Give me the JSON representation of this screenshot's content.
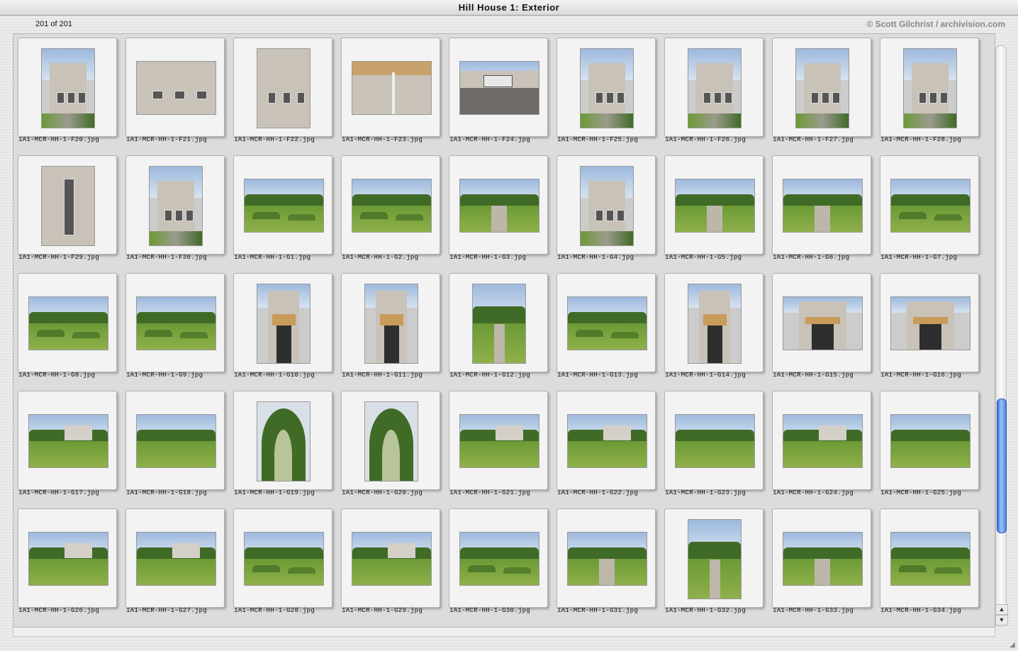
{
  "window": {
    "title": "Hill House 1: Exterior",
    "count_text": "201 of 201",
    "copyright": "© Scott Gilchrist / archivision.com"
  },
  "scroll": {
    "position": 0.72
  },
  "thumbnails": [
    {
      "label": "1A1-MCR-HH-1-F20.jpg",
      "orient": "portrait",
      "scene": "house"
    },
    {
      "label": "1A1-MCR-HH-1-F21.jpg",
      "orient": "landscape",
      "scene": "wall"
    },
    {
      "label": "1A1-MCR-HH-1-F22.jpg",
      "orient": "portrait",
      "scene": "wall"
    },
    {
      "label": "1A1-MCR-HH-1-F23.jpg",
      "orient": "landscape",
      "scene": "detail"
    },
    {
      "label": "1A1-MCR-HH-1-F24.jpg",
      "orient": "landscape",
      "scene": "roof"
    },
    {
      "label": "1A1-MCR-HH-1-F25.jpg",
      "orient": "portrait",
      "scene": "house"
    },
    {
      "label": "1A1-MCR-HH-1-F26.jpg",
      "orient": "portrait",
      "scene": "tower"
    },
    {
      "label": "1A1-MCR-HH-1-F27.jpg",
      "orient": "portrait",
      "scene": "tower"
    },
    {
      "label": "1A1-MCR-HH-1-F28.jpg",
      "orient": "portrait",
      "scene": "tower"
    },
    {
      "label": "1A1-MCR-HH-1-F29.jpg",
      "orient": "portrait",
      "scene": "window"
    },
    {
      "label": "1A1-MCR-HH-1-F30.jpg",
      "orient": "portrait",
      "scene": "tower"
    },
    {
      "label": "1A1-MCR-HH-1-G1.jpg",
      "orient": "landscape",
      "scene": "garden"
    },
    {
      "label": "1A1-MCR-HH-1-G2.jpg",
      "orient": "landscape",
      "scene": "garden"
    },
    {
      "label": "1A1-MCR-HH-1-G3.jpg",
      "orient": "landscape",
      "scene": "path"
    },
    {
      "label": "1A1-MCR-HH-1-G4.jpg",
      "orient": "portrait",
      "scene": "house"
    },
    {
      "label": "1A1-MCR-HH-1-G5.jpg",
      "orient": "landscape",
      "scene": "path"
    },
    {
      "label": "1A1-MCR-HH-1-G6.jpg",
      "orient": "landscape",
      "scene": "path"
    },
    {
      "label": "1A1-MCR-HH-1-G7.jpg",
      "orient": "landscape",
      "scene": "garden"
    },
    {
      "label": "1A1-MCR-HH-1-G8.jpg",
      "orient": "landscape",
      "scene": "garden"
    },
    {
      "label": "1A1-MCR-HH-1-G9.jpg",
      "orient": "landscape",
      "scene": "garden"
    },
    {
      "label": "1A1-MCR-HH-1-G10.jpg",
      "orient": "portrait",
      "scene": "doorway"
    },
    {
      "label": "1A1-MCR-HH-1-G11.jpg",
      "orient": "portrait",
      "scene": "doorway"
    },
    {
      "label": "1A1-MCR-HH-1-G12.jpg",
      "orient": "portrait",
      "scene": "path"
    },
    {
      "label": "1A1-MCR-HH-1-G13.jpg",
      "orient": "landscape",
      "scene": "garden"
    },
    {
      "label": "1A1-MCR-HH-1-G14.jpg",
      "orient": "portrait",
      "scene": "doorway"
    },
    {
      "label": "1A1-MCR-HH-1-G15.jpg",
      "orient": "landscape",
      "scene": "doorway"
    },
    {
      "label": "1A1-MCR-HH-1-G16.jpg",
      "orient": "landscape",
      "scene": "doorway"
    },
    {
      "label": "1A1-MCR-HH-1-G17.jpg",
      "orient": "landscape",
      "scene": "lawnhouse"
    },
    {
      "label": "1A1-MCR-HH-1-G18.jpg",
      "orient": "landscape",
      "scene": "lawn"
    },
    {
      "label": "1A1-MCR-HH-1-G19.jpg",
      "orient": "portrait",
      "scene": "arch"
    },
    {
      "label": "1A1-MCR-HH-1-G20.jpg",
      "orient": "portrait",
      "scene": "arch"
    },
    {
      "label": "1A1-MCR-HH-1-G21.jpg",
      "orient": "landscape",
      "scene": "lawnhouse"
    },
    {
      "label": "1A1-MCR-HH-1-G22.jpg",
      "orient": "landscape",
      "scene": "lawnhouse"
    },
    {
      "label": "1A1-MCR-HH-1-G23.jpg",
      "orient": "landscape",
      "scene": "lawn"
    },
    {
      "label": "1A1-MCR-HH-1-G24.jpg",
      "orient": "landscape",
      "scene": "lawnhouse"
    },
    {
      "label": "1A1-MCR-HH-1-G25.jpg",
      "orient": "landscape",
      "scene": "lawn"
    },
    {
      "label": "1A1-MCR-HH-1-G26.jpg",
      "orient": "landscape",
      "scene": "lawnhouse"
    },
    {
      "label": "1A1-MCR-HH-1-G27.jpg",
      "orient": "landscape",
      "scene": "lawnhouse"
    },
    {
      "label": "1A1-MCR-HH-1-G28.jpg",
      "orient": "landscape",
      "scene": "garden"
    },
    {
      "label": "1A1-MCR-HH-1-G29.jpg",
      "orient": "landscape",
      "scene": "lawnhouse"
    },
    {
      "label": "1A1-MCR-HH-1-G30.jpg",
      "orient": "landscape",
      "scene": "garden"
    },
    {
      "label": "1A1-MCR-HH-1-G31.jpg",
      "orient": "landscape",
      "scene": "path"
    },
    {
      "label": "1A1-MCR-HH-1-G32.jpg",
      "orient": "portrait",
      "scene": "path"
    },
    {
      "label": "1A1-MCR-HH-1-G33.jpg",
      "orient": "landscape",
      "scene": "path"
    },
    {
      "label": "1A1-MCR-HH-1-G34.jpg",
      "orient": "landscape",
      "scene": "garden"
    }
  ]
}
